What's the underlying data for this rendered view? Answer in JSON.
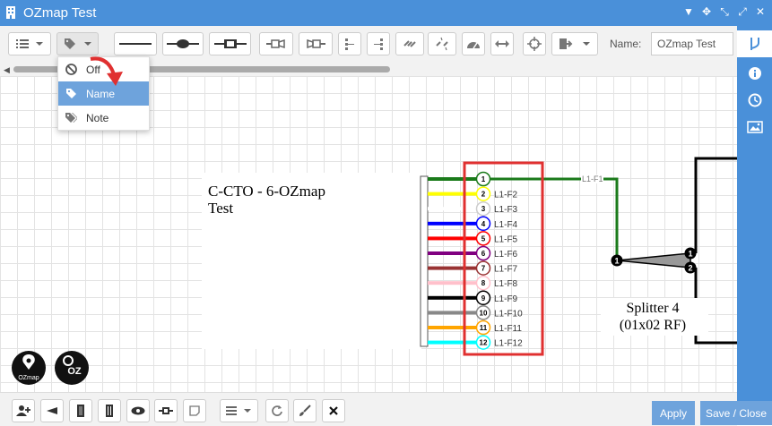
{
  "window": {
    "title": "OZmap Test"
  },
  "toolbar": {
    "name_label": "Name:",
    "name_value": "OZmap Test"
  },
  "label_menu": {
    "items": [
      {
        "label": "Off",
        "icon": "ban-icon"
      },
      {
        "label": "Name",
        "icon": "tag-icon",
        "selected": true
      },
      {
        "label": "Note",
        "icon": "tags-icon"
      }
    ]
  },
  "diagram": {
    "cto_label_line1": "C-CTO - 6-OZmap",
    "cto_label_line2": "Test",
    "fibers": [
      {
        "num": "1",
        "label": "L1-F1",
        "color": "#1a7a1a"
      },
      {
        "num": "2",
        "label": "L1-F2",
        "color": "#ffff00"
      },
      {
        "num": "3",
        "label": "L1-F3",
        "color": "#ffffff"
      },
      {
        "num": "4",
        "label": "L1-F4",
        "color": "#0000ff"
      },
      {
        "num": "5",
        "label": "L1-F5",
        "color": "#ff0000"
      },
      {
        "num": "6",
        "label": "L1-F6",
        "color": "#800080"
      },
      {
        "num": "7",
        "label": "L1-F7",
        "color": "#993333"
      },
      {
        "num": "8",
        "label": "L1-F8",
        "color": "#ffc0cb"
      },
      {
        "num": "9",
        "label": "L1-F9",
        "color": "#000000"
      },
      {
        "num": "10",
        "label": "L1-F10",
        "color": "#888888"
      },
      {
        "num": "11",
        "label": "L1-F11",
        "color": "#ffa500"
      },
      {
        "num": "12",
        "label": "L1-F12",
        "color": "#00ffff"
      }
    ],
    "splitter_line1": "Splitter 4",
    "splitter_line2": "(01x02 RF)",
    "splitter_in": "1",
    "splitter_out1": "1",
    "splitter_out2": "2",
    "logo1_text": "OZmap",
    "logo2_text": "OZ"
  },
  "bottom": {
    "apply_label": "Apply",
    "save_close_label": "Save / Close"
  },
  "colors": {
    "accent": "#4a90d9",
    "button_blue": "#6ea3dc",
    "highlight_red": "#e03030"
  }
}
